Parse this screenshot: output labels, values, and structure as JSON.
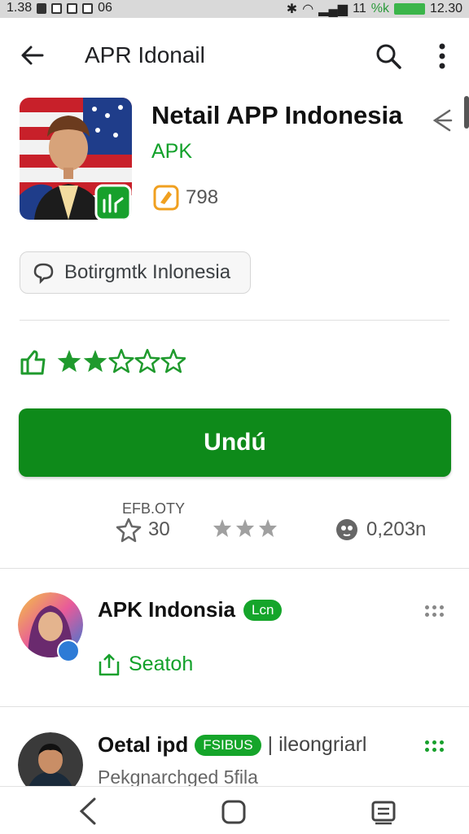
{
  "status_bar": {
    "time": "1.38",
    "left_extra": "06",
    "signal": "11",
    "network": "%k",
    "battery": "12.30"
  },
  "toolbar": {
    "title": "APR Idonail"
  },
  "app": {
    "title": "Netail APP Indonesia",
    "subtitle": "APK",
    "rating_count": "798",
    "chip_label": "Botirgmtk Inlonesia",
    "stars_filled": 2.5,
    "stars_total": 5,
    "install_label": "Undú",
    "stats_label": "EFB.OTY",
    "stat_stars": "30",
    "stat_downloads": "0,203n"
  },
  "list": [
    {
      "name": "APK Indonsia",
      "badge": "Lcn",
      "link": "Seatoh"
    },
    {
      "name": "Oetal ipd",
      "badge": "FSIBUS",
      "extra": "| ileongriarl",
      "subtitle": "Pekgnarchged 5fila"
    }
  ],
  "colors": {
    "accent": "#0e8a1a",
    "link": "#12a12a",
    "star": "#1f9a2d",
    "rating_icon": "#f0a020"
  }
}
